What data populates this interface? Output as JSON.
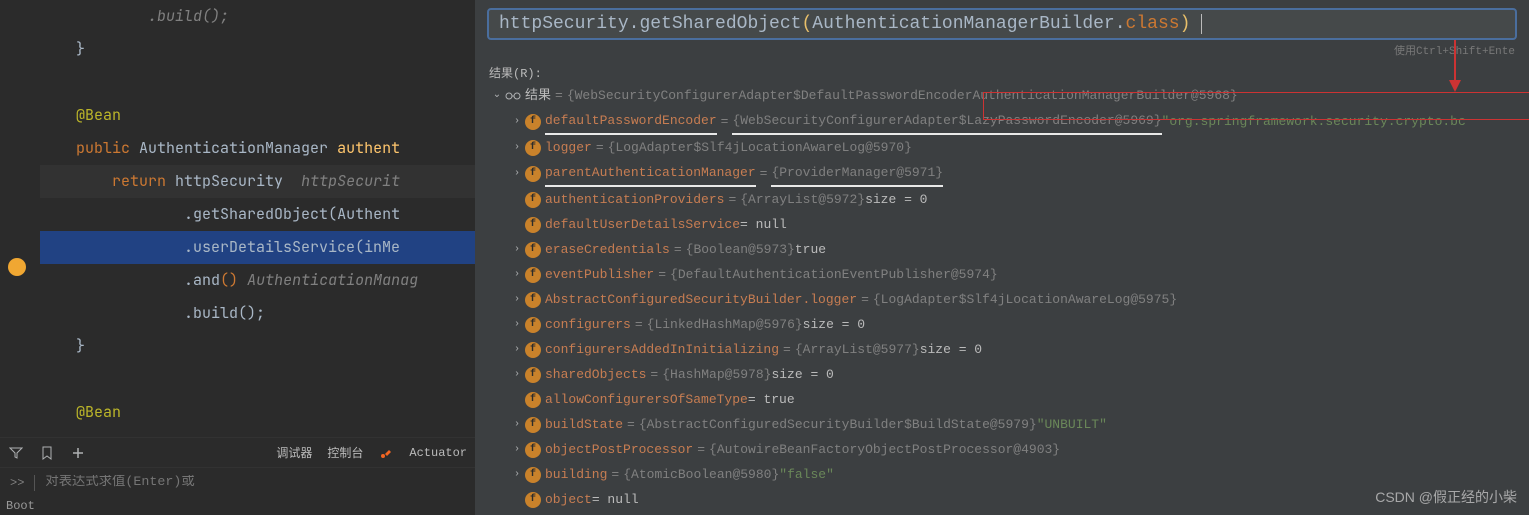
{
  "code": {
    "l1": "            .build();",
    "l2": "    }",
    "ann": "@Bean",
    "pub": "public",
    "type": "AuthenticationManager",
    "meth": "authent",
    "ret": "return",
    "var": "httpSecurity",
    "gray": "httpSecurit",
    "g1a": ".",
    "g1b": "getSharedObject",
    "g1c": "(",
    "g1d": "Authent",
    "g2a": ".",
    "g2b": "userDetailsService",
    "g2c": "(inMe",
    "g3a": ".",
    "g3b": "and",
    "g3c": "()",
    "g3d": " AuthenticationManag",
    "g4a": ".",
    "g4b": "build",
    "g4c": "();",
    "l10": "    }",
    "ann2": "@Bean"
  },
  "toolbar": {
    "debugger": "调试器",
    "console": "控制台",
    "actuator": "Actuator",
    "more": ">>",
    "placeholder": "对表达式求值(Enter)或",
    "boot": "Boot"
  },
  "eval": {
    "expr_httpVar": "httpSecurity",
    "expr_dot1": ".",
    "expr_m1": "getSharedObject",
    "expr_p1": "(",
    "expr_cls": "AuthenticationManagerBuilder",
    "expr_dot2": ".",
    "expr_kw": "class",
    "expr_p2": ")",
    "hint": "使用Ctrl+Shift+Ente",
    "resultLabel": "结果(R):"
  },
  "tree": [
    {
      "depth": 0,
      "tw": "v",
      "icon": "glasses",
      "name": "结果",
      "val": "{WebSecurityConfigurerAdapter$DefaultPasswordEncoderAuthenticationManagerBuilder@5968}",
      "redbox": true
    },
    {
      "depth": 1,
      "tw": ">",
      "icon": "f",
      "name": "defaultPasswordEncoder",
      "val": "{WebSecurityConfigurerAdapter$LazyPasswordEncoder@5969}",
      "suffix": " \"org.springframework.security.crypto.bc",
      "ul_name": true,
      "ul_val": true
    },
    {
      "depth": 1,
      "tw": ">",
      "icon": "f",
      "name": "logger",
      "val": "{LogAdapter$Slf4jLocationAwareLog@5970}"
    },
    {
      "depth": 1,
      "tw": ">",
      "icon": "f",
      "name": "parentAuthenticationManager",
      "val": "{ProviderManager@5971}",
      "ul_name": true,
      "ul_val": true
    },
    {
      "depth": 1,
      "tw": "",
      "icon": "f",
      "name": "authenticationProviders",
      "val": "{ArrayList@5972}",
      "suffix2": "  size = 0"
    },
    {
      "depth": 1,
      "tw": "",
      "icon": "f",
      "name": "defaultUserDetailsService",
      "plain": " = null"
    },
    {
      "depth": 1,
      "tw": ">",
      "icon": "f",
      "name": "eraseCredentials",
      "val": "{Boolean@5973}",
      "suffix2": " true"
    },
    {
      "depth": 1,
      "tw": ">",
      "icon": "f",
      "name": "eventPublisher",
      "val": "{DefaultAuthenticationEventPublisher@5974}"
    },
    {
      "depth": 1,
      "tw": ">",
      "icon": "f",
      "name": "AbstractConfiguredSecurityBuilder.logger",
      "val": "{LogAdapter$Slf4jLocationAwareLog@5975}"
    },
    {
      "depth": 1,
      "tw": ">",
      "icon": "f",
      "name": "configurers",
      "val": "{LinkedHashMap@5976}",
      "suffix2": "  size = 0"
    },
    {
      "depth": 1,
      "tw": ">",
      "icon": "f",
      "name": "configurersAddedInInitializing",
      "val": "{ArrayList@5977}",
      "suffix2": "  size = 0"
    },
    {
      "depth": 1,
      "tw": ">",
      "icon": "f",
      "name": "sharedObjects",
      "val": "{HashMap@5978}",
      "suffix2": "  size = 0"
    },
    {
      "depth": 1,
      "tw": "",
      "icon": "f",
      "name": "allowConfigurersOfSameType",
      "plain": " = true"
    },
    {
      "depth": 1,
      "tw": ">",
      "icon": "f",
      "name": "buildState",
      "val": "{AbstractConfiguredSecurityBuilder$BuildState@5979}",
      "suffix": " \"UNBUILT\""
    },
    {
      "depth": 1,
      "tw": ">",
      "icon": "f",
      "name": "objectPostProcessor",
      "val": "{AutowireBeanFactoryObjectPostProcessor@4903}"
    },
    {
      "depth": 1,
      "tw": ">",
      "icon": "f",
      "name": "building",
      "val": "{AtomicBoolean@5980}",
      "suffix": " \"false\""
    },
    {
      "depth": 1,
      "tw": "",
      "icon": "f",
      "name": "object",
      "plain": " = null"
    }
  ],
  "watermark": "CSDN @假正经的小柴"
}
